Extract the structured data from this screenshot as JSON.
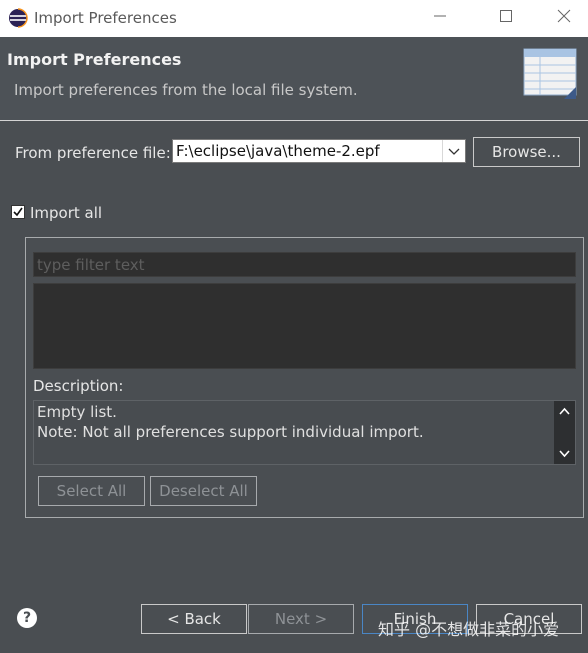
{
  "window": {
    "title": "Import Preferences",
    "controls": [
      "minimize",
      "maximize",
      "close"
    ]
  },
  "header": {
    "title": "Import Preferences",
    "subtitle": "Import preferences from the local file system."
  },
  "form": {
    "file_label": "From preference file:",
    "file_value": "F:\\eclipse\\java\\theme-2.epf",
    "browse_label": "Browse...",
    "import_all_label": "Import all",
    "import_all_checked": true,
    "filter_placeholder": "type filter text",
    "description_label": "Description:",
    "description_lines": [
      "Empty list.",
      "Note: Not all preferences support individual import."
    ],
    "select_all_label": "Select All",
    "deselect_all_label": "Deselect All"
  },
  "footer": {
    "help_icon": "?",
    "back_label": "< Back",
    "next_label": "Next >",
    "finish_label": "Finish",
    "cancel_label": "Cancel"
  },
  "watermark": "知乎 @不想做非菜的小爱",
  "colors": {
    "background": "#4a4e52",
    "header_background": "#4d5257",
    "field_dark": "#2f2f2f",
    "title_bar": "#ffffff"
  }
}
